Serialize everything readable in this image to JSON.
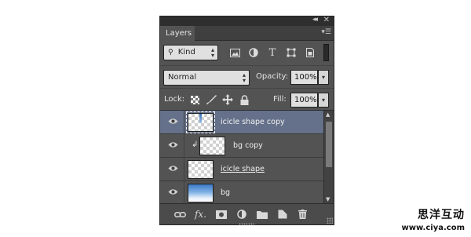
{
  "titlebar": {
    "collapse_icon": "double-chevron-left-icon",
    "close_icon": "close-icon",
    "collapse_glyph": "◂◂",
    "close_glyph": "✕"
  },
  "tab": {
    "label": "Layers",
    "menu_icon": "panel-menu-icon",
    "menu_glyph": "▾☰"
  },
  "filter": {
    "kind_label": "Kind",
    "icons": [
      "image-filter-icon",
      "adjustment-filter-icon",
      "type-filter-icon",
      "shape-filter-icon",
      "smart-object-filter-icon"
    ]
  },
  "blend": {
    "mode": "Normal",
    "opacity_label": "Opacity:",
    "opacity_value": "100%"
  },
  "lock": {
    "label": "Lock:",
    "icons": [
      "lock-transparent-pixels-icon",
      "lock-image-pixels-icon",
      "lock-position-icon",
      "lock-all-icon"
    ],
    "fill_label": "Fill:",
    "fill_value": "100%"
  },
  "layers": [
    {
      "name": "icicle shape copy",
      "selected": true,
      "clipped": false,
      "thumb": "icicle"
    },
    {
      "name": "bg copy",
      "selected": false,
      "clipped": true,
      "thumb": "transparent"
    },
    {
      "name": "icicle shape",
      "selected": false,
      "clipped": false,
      "thumb": "transparent"
    },
    {
      "name": "bg",
      "selected": false,
      "clipped": false,
      "thumb": "sky"
    }
  ],
  "bottom_icons": [
    "link-layers-icon",
    "fx-icon",
    "add-mask-icon",
    "adjustment-layer-icon",
    "new-group-icon",
    "new-layer-icon",
    "trash-icon"
  ],
  "watermark": {
    "chinese": "思洋互动",
    "url": "www.ciya.com"
  },
  "colors": {
    "panel": "#535353",
    "selected_row": "#65718a",
    "titlebar": "#2e2e2e"
  }
}
